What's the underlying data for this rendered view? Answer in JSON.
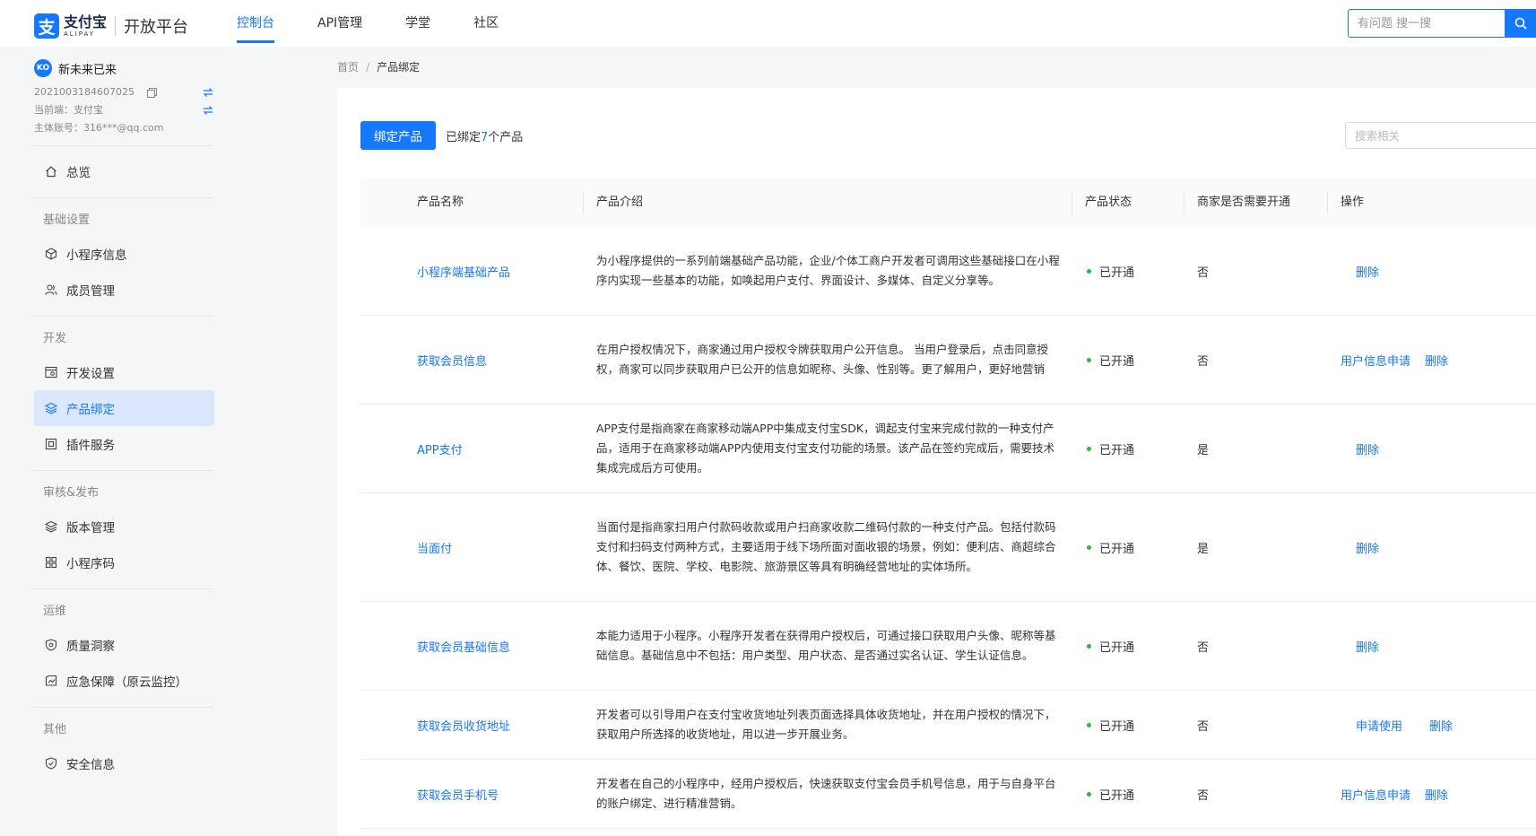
{
  "header": {
    "logo_mark": "支",
    "logo_cn": "支付宝",
    "logo_en": "ALIPAY",
    "platform": "开放平台",
    "nav": [
      {
        "label": "控制台",
        "active": true
      },
      {
        "label": "API管理",
        "active": false
      },
      {
        "label": "学堂",
        "active": false
      },
      {
        "label": "社区",
        "active": false
      }
    ],
    "search_placeholder": "有问题 搜一搜"
  },
  "sidebar": {
    "app_avatar": "KO",
    "app_name": "新未来已来",
    "app_id": "2021003184607025",
    "current_end": "当前端：支付宝",
    "main_account": "主体账号：316***@qq.com",
    "overview": "总览",
    "groups": [
      {
        "title": "基础设置",
        "items": [
          "小程序信息",
          "成员管理"
        ]
      },
      {
        "title": "开发",
        "items": [
          "开发设置",
          "产品绑定",
          "插件服务"
        ]
      },
      {
        "title": "审核&发布",
        "items": [
          "版本管理",
          "小程序码"
        ]
      },
      {
        "title": "运维",
        "items": [
          "质量洞察",
          "应急保障（原云监控）"
        ]
      },
      {
        "title": "其他",
        "items": [
          "安全信息"
        ]
      }
    ]
  },
  "breadcrumb": {
    "home": "首页",
    "separator": "/",
    "current": "产品绑定"
  },
  "toolbar": {
    "bind_button": "绑定产品",
    "bound_prefix": "已绑定",
    "bound_count": "7",
    "bound_suffix": "个产品",
    "search_placeholder": "搜索相关"
  },
  "table": {
    "columns": [
      "产品名称",
      "产品介绍",
      "产品状态",
      "商家是否需要开通",
      "操作"
    ],
    "rows": [
      {
        "name": "小程序端基础产品",
        "desc": "为小程序提供的一系列前端基础产品功能，企业/个体工商户开发者可调用这些基础接口在小程序内实现一些基本的功能，如唤起用户支付、界面设计、多媒体、自定义分享等。",
        "status": "已开通",
        "need": "否",
        "ops": [
          "删除"
        ]
      },
      {
        "name": "获取会员信息",
        "desc": "在用户授权情况下，商家通过用户授权令牌获取用户公开信息。 当用户登录后，点击同意授权，商家可以同步获取用户已公开的信息如昵称、头像、性别等。更了解用户，更好地营销",
        "status": "已开通",
        "need": "否",
        "ops": [
          "用户信息申请",
          "删除"
        ]
      },
      {
        "name": "APP支付",
        "desc": "APP支付是指商家在商家移动端APP中集成支付宝SDK，调起支付宝来完成付款的一种支付产品，适用于在商家移动端APP内使用支付宝支付功能的场景。该产品在签约完成后，需要技术集成完成后方可使用。",
        "status": "已开通",
        "need": "是",
        "ops": [
          "删除"
        ]
      },
      {
        "name": "当面付",
        "desc": "当面付是指商家扫用户付款码收款或用户扫商家收款二维码付款的一种支付产品。包括付款码支付和扫码支付两种方式，主要适用于线下场所面对面收银的场景，例如：便利店、商超综合体、餐饮、医院、学校、电影院、旅游景区等具有明确经营地址的实体场所。",
        "status": "已开通",
        "need": "是",
        "ops": [
          "删除"
        ]
      },
      {
        "name": "获取会员基础信息",
        "desc": "本能力适用于小程序。小程序开发者在获得用户授权后，可通过接口获取用户头像、昵称等基础信息。基础信息中不包括：用户类型、用户状态、是否通过实名认证、学生认证信息。",
        "status": "已开通",
        "need": "否",
        "ops": [
          "删除"
        ]
      },
      {
        "name": "获取会员收货地址",
        "desc": "开发者可以引导用户在支付宝收货地址列表页面选择具体收货地址，并在用户授权的情况下，获取用户所选择的收货地址，用以进一步开展业务。",
        "status": "已开通",
        "need": "否",
        "ops": [
          "申请使用",
          "删除"
        ]
      },
      {
        "name": "获取会员手机号",
        "desc": "开发者在自己的小程序中，经用户授权后，快速获取支付宝会员手机号信息，用于与自身平台的账户绑定、进行精准营销。",
        "status": "已开通",
        "need": "否",
        "ops": [
          "用户信息申请",
          "删除"
        ]
      }
    ]
  },
  "colors": {
    "accent": "#1677ff",
    "active_bg": "#dbe8fb",
    "status_green": "#2eb83f"
  }
}
